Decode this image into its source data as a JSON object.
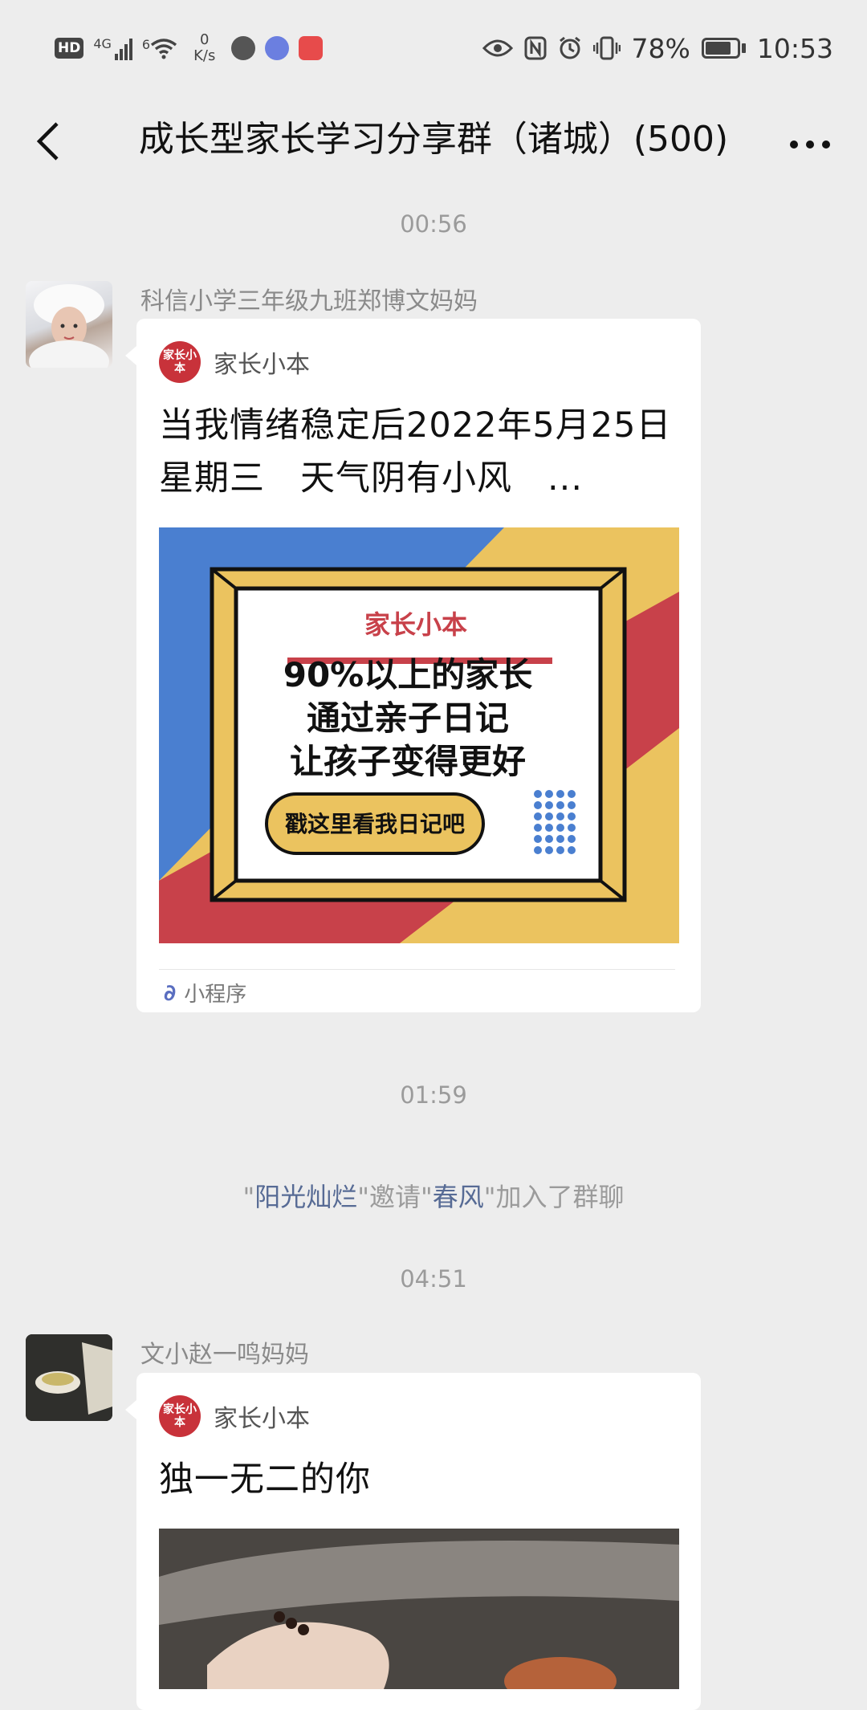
{
  "status_bar": {
    "hd": "HD",
    "network": "4G",
    "wifi_level": "6",
    "speed_value": "0",
    "speed_unit": "K/s",
    "battery": "78%",
    "time": "10:53"
  },
  "header": {
    "back_icon": "chevron-left-icon",
    "title": "成长型家长学习分享群（诸城）(500)",
    "more_icon": "more-dots-icon"
  },
  "messages": {
    "time1": "00:56",
    "msg1": {
      "sender": "科信小学三年级九班郑博文妈妈",
      "card": {
        "app_logo_text": "家长小本",
        "app_name": "家长小本",
        "title": "当我情绪稳定后2022年5月25日　星期三　天气阴有小风　...",
        "image": {
          "brand": "家长小本",
          "line1": "90%以上的家长",
          "line2": "通过亲子日记",
          "line3": "让孩子变得更好",
          "button": "戳这里看我日记吧"
        },
        "footer": "小程序"
      }
    },
    "time2": "01:59",
    "system": {
      "q1": "\"",
      "inviter": "阳光灿烂",
      "mid": "\"邀请\"",
      "invitee": "春风",
      "tail": "\"加入了群聊"
    },
    "time3": "04:51",
    "msg2": {
      "sender": "文小赵一鸣妈妈",
      "card": {
        "app_logo_text": "家长小本",
        "app_name": "家长小本",
        "title": "独一无二的你"
      }
    }
  },
  "colors": {
    "background": "#ededed",
    "link_blue": "#576b95",
    "brand_red": "#c8323a",
    "card_blue": "#4a7fd0",
    "card_red": "#c8414a",
    "card_yellow": "#ebc35f"
  }
}
